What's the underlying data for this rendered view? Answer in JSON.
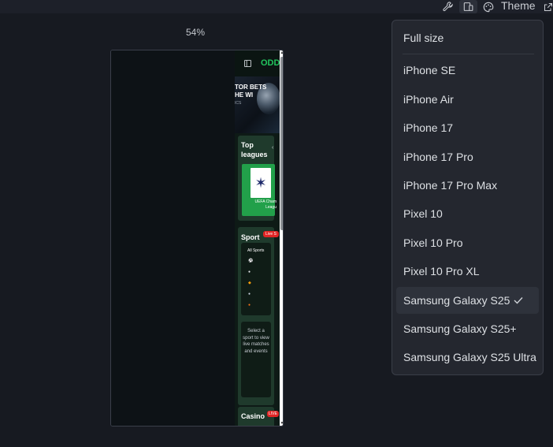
{
  "toolbar": {
    "theme_label": "Theme",
    "icons": [
      "wrench-icon",
      "devices-icon",
      "palette-icon",
      "external-link-icon"
    ]
  },
  "preview": {
    "zoom_label": "54%"
  },
  "app": {
    "logo_text": "ODD",
    "banner_line1": "TOR BETS",
    "banner_line2": "HE WI",
    "banner_sub": "ICS",
    "top_leagues_title": "Top leagues",
    "league_name": "UEFA Cham Leagu",
    "sport_title": "Sport",
    "live_badge": "Live S",
    "all_sports": "All Sports",
    "select_message": "Select a sport to view live matches and events",
    "casino_title": "Casino",
    "casino_badge": "LIVE"
  },
  "device_menu": {
    "items": [
      {
        "label": "Full size"
      },
      {
        "label": "iPhone SE"
      },
      {
        "label": "iPhone Air"
      },
      {
        "label": "iPhone 17"
      },
      {
        "label": "iPhone 17 Pro"
      },
      {
        "label": "iPhone 17 Pro Max"
      },
      {
        "label": "Pixel 10"
      },
      {
        "label": "Pixel 10 Pro"
      },
      {
        "label": "Pixel 10 Pro XL"
      },
      {
        "label": "Samsung Galaxy S25",
        "selected": true
      },
      {
        "label": "Samsung Galaxy S25+"
      },
      {
        "label": "Samsung Galaxy S25 Ultra"
      }
    ]
  },
  "colors": {
    "background": "#171a21",
    "menu_bg": "#24272f",
    "brand_green": "#22c55e",
    "live_red": "#e02424"
  }
}
